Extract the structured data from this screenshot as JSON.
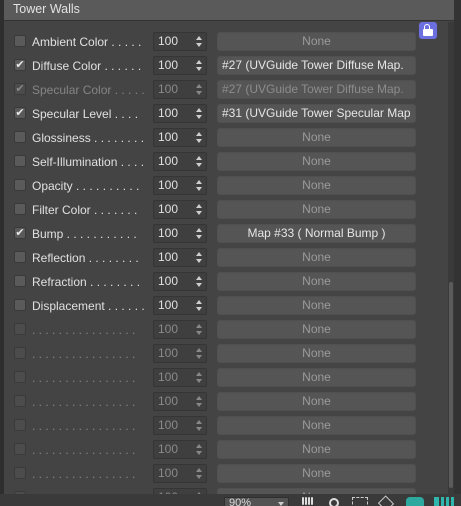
{
  "panel": {
    "title": "Tower Walls"
  },
  "maps_header": {
    "rows": [
      {
        "checked": false,
        "dim": false,
        "label": "Ambient Color . . . . .",
        "amount": "100",
        "map": "None",
        "map_style": "none"
      },
      {
        "checked": true,
        "dim": false,
        "label": "Diffuse Color . . . . . .",
        "amount": "100",
        "map": "#27 (UVGuide Tower Diffuse Map.",
        "map_style": "text"
      },
      {
        "checked": true,
        "dim": true,
        "label": "Specular Color . . . . .",
        "amount": "100",
        "map": "#27 (UVGuide Tower Diffuse Map.",
        "map_style": "dimtext"
      },
      {
        "checked": true,
        "dim": false,
        "label": "Specular Level . . . .",
        "amount": "100",
        "map": "#31 (UVGuide Tower Specular Map",
        "map_style": "text"
      },
      {
        "checked": false,
        "dim": false,
        "label": "Glossiness . . . . . . . .",
        "amount": "100",
        "map": "None",
        "map_style": "none"
      },
      {
        "checked": false,
        "dim": false,
        "label": "Self-Illumination . . . .",
        "amount": "100",
        "map": "None",
        "map_style": "none"
      },
      {
        "checked": false,
        "dim": false,
        "label": "Opacity . . . . . . . . . .",
        "amount": "100",
        "map": "None",
        "map_style": "none"
      },
      {
        "checked": false,
        "dim": false,
        "label": "Filter Color . . . . . . .",
        "amount": "100",
        "map": "None",
        "map_style": "none"
      },
      {
        "checked": true,
        "dim": false,
        "label": "Bump . . . . . . . . . . .",
        "amount": "100",
        "map": "Map #33  ( Normal Bump )",
        "map_style": "center"
      },
      {
        "checked": false,
        "dim": false,
        "label": "Reflection . . . . . . . .",
        "amount": "100",
        "map": "None",
        "map_style": "none"
      },
      {
        "checked": false,
        "dim": false,
        "label": "Refraction . . . . . . . .",
        "amount": "100",
        "map": "None",
        "map_style": "none"
      },
      {
        "checked": false,
        "dim": false,
        "label": "Displacement . . . . . .",
        "amount": "100",
        "map": "None",
        "map_style": "none"
      },
      {
        "checked": false,
        "dim": true,
        "label": ". . . . . . . . . . . . . . . .",
        "amount": "100",
        "map": "None",
        "map_style": "none"
      },
      {
        "checked": false,
        "dim": true,
        "label": ". . . . . . . . . . . . . . . .",
        "amount": "100",
        "map": "None",
        "map_style": "none"
      },
      {
        "checked": false,
        "dim": true,
        "label": ". . . . . . . . . . . . . . . .",
        "amount": "100",
        "map": "None",
        "map_style": "none"
      },
      {
        "checked": false,
        "dim": true,
        "label": ". . . . . . . . . . . . . . . .",
        "amount": "100",
        "map": "None",
        "map_style": "none"
      },
      {
        "checked": false,
        "dim": true,
        "label": ". . . . . . . . . . . . . . . .",
        "amount": "100",
        "map": "None",
        "map_style": "none"
      },
      {
        "checked": false,
        "dim": true,
        "label": ". . . . . . . . . . . . . . . .",
        "amount": "100",
        "map": "None",
        "map_style": "none"
      },
      {
        "checked": false,
        "dim": true,
        "label": ". . . . . . . . . . . . . . . .",
        "amount": "100",
        "map": "None",
        "map_style": "none"
      },
      {
        "checked": false,
        "dim": true,
        "label": ". . . . . . . . . . . . . . . .",
        "amount": "100",
        "map": "None",
        "map_style": "none"
      }
    ]
  },
  "icons": {
    "lock": "lock-icon",
    "hand": "pan-hand-icon",
    "search": "zoom-search-icon",
    "region": "zoom-region-icon",
    "nav": "navigation-icon",
    "teal": "layout-icon",
    "grid": "grid-icon"
  },
  "statusbar": {
    "zoom": "90%"
  },
  "colors": {
    "accent": "#6c6fe0",
    "teal": "#2ea9a0"
  }
}
